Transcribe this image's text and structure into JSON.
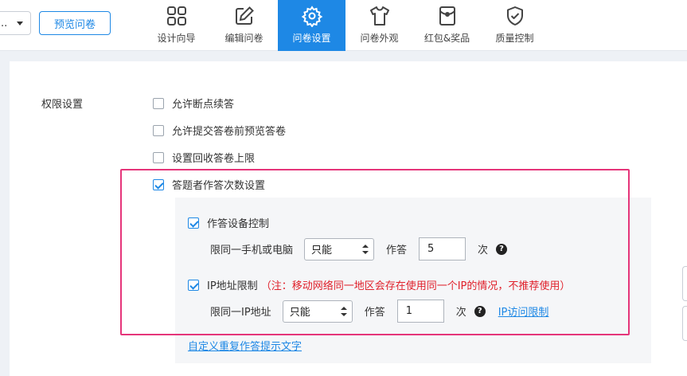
{
  "header": {
    "survey_select_value": "..",
    "preview_label": "预览问卷",
    "nav": [
      {
        "label": "设计向导",
        "icon": "grid-icon"
      },
      {
        "label": "编辑问卷",
        "icon": "edit-icon"
      },
      {
        "label": "问卷设置",
        "icon": "gear-icon"
      },
      {
        "label": "问卷外观",
        "icon": "shirt-icon"
      },
      {
        "label": "红包&奖品",
        "icon": "red-envelope-icon"
      },
      {
        "label": "质量控制",
        "icon": "shield-check-icon"
      }
    ],
    "active_tab": "问卷设置"
  },
  "settings": {
    "section_label": "权限设置",
    "options": [
      {
        "label": "允许断点续答",
        "checked": false
      },
      {
        "label": "允许提交答卷前预览答卷",
        "checked": false
      },
      {
        "label": "设置回收答卷上限",
        "checked": false
      },
      {
        "label": "答题者作答次数设置",
        "checked": true
      }
    ],
    "device": {
      "label": "作答设备控制",
      "checked": true,
      "row_prefix": "限同一手机或电脑",
      "select_value": "只能",
      "mid_label": "作答",
      "count": "5",
      "unit": "次"
    },
    "ip": {
      "label": "IP地址限制",
      "checked": true,
      "warning": "（注：移动网络同一地区会存在使用同一个IP的情况，不推荐使用）",
      "row_prefix": "限同一IP地址",
      "select_value": "只能",
      "mid_label": "作答",
      "count": "1",
      "unit": "次",
      "link": "IP访问限制"
    },
    "custom_link": "自定义重复作答提示文字"
  },
  "colors": {
    "accent": "#1e88e5",
    "highlight": "#e5357a",
    "warning": "#e0212b"
  }
}
